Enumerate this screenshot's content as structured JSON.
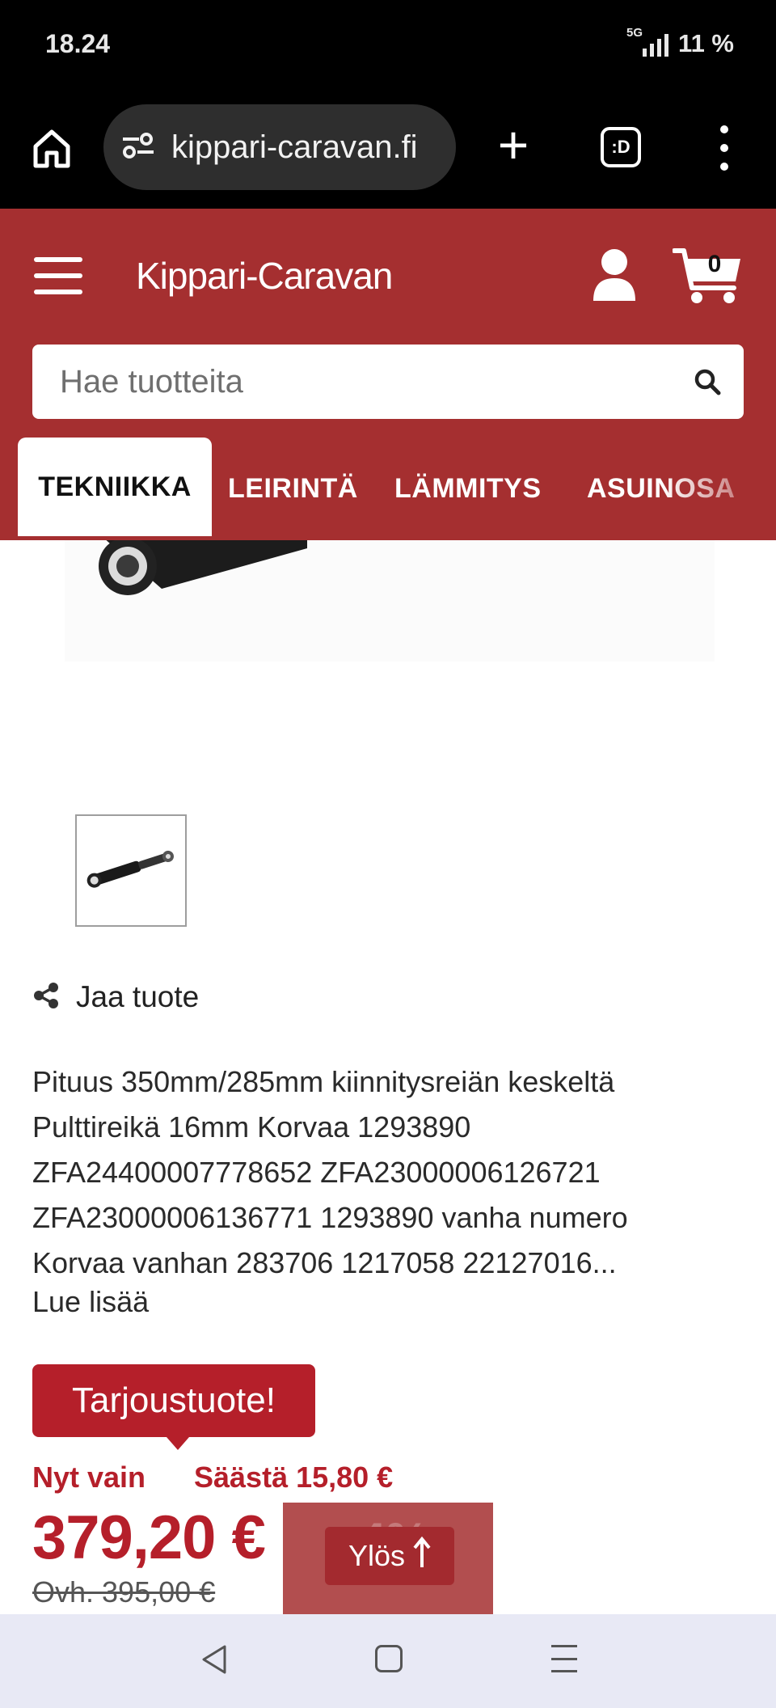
{
  "status_bar": {
    "time": "18.24",
    "network": "5G",
    "battery": "11 %"
  },
  "browser": {
    "url": "kippari-caravan.fi",
    "tabs_label": ":D"
  },
  "header": {
    "logo": "Kippari-Caravan",
    "cart_count": "0",
    "search_placeholder": "Hae tuotteita",
    "categories": [
      "TEKNIIKKA",
      "LEIRINTÄ",
      "LÄMMITYS",
      "ASUINOSA"
    ]
  },
  "product": {
    "share_label": "Jaa tuote",
    "description_lines": [
      "Pituus 350mm/285mm kiinnitysreiän keskeltä",
      "Pulttireikä 16mm Korvaa 1293890",
      "ZFA24400007778652 ZFA23000006126721",
      "ZFA23000006136771 1293890 vanha numero",
      "Korvaa vanhan 283706 1217058 22127016..."
    ],
    "read_more": "Lue lisää",
    "offer_badge": "Tarjoustuote!",
    "now_only": "Nyt vain",
    "save": "Säästä 15,80 €",
    "price": "379,20 €",
    "old_price": "Ovh. 395,00 €",
    "discount": "-4%"
  },
  "scroll_up": {
    "label": "Ylös"
  },
  "colors": {
    "brand_red": "#a52f30",
    "price_red": "#b51f2a"
  }
}
